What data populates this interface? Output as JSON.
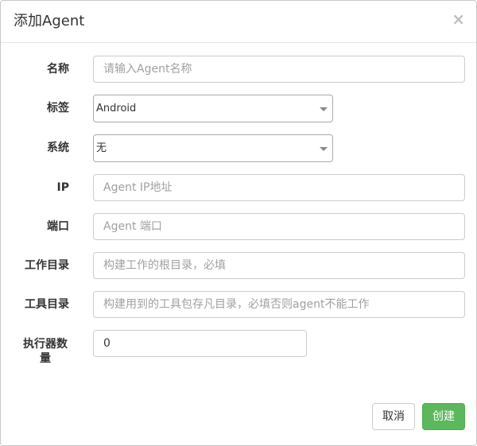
{
  "dialog": {
    "title": "添加Agent",
    "close_label": "×"
  },
  "form": {
    "name": {
      "label": "名称",
      "placeholder": "请输入Agent名称",
      "value": ""
    },
    "tag": {
      "label": "标签",
      "selected": "Android"
    },
    "system": {
      "label": "系统",
      "selected": "无"
    },
    "ip": {
      "label": "IP",
      "placeholder": "Agent IP地址",
      "value": ""
    },
    "port": {
      "label": "端口",
      "placeholder": "Agent 端口",
      "value": ""
    },
    "workdir": {
      "label": "工作目录",
      "placeholder": "构建工作的根目录，必填",
      "value": ""
    },
    "tooldir": {
      "label": "工具目录",
      "placeholder": "构建用到的工具包存凡目录，必填否则agent不能工作",
      "value": ""
    },
    "executors": {
      "label_line1": "执行器数",
      "label_line2": "量",
      "value": "0"
    }
  },
  "footer": {
    "cancel_label": "取消",
    "create_label": "创建"
  },
  "colors": {
    "primary_green": "#5cb85c",
    "border": "#cccccc"
  }
}
